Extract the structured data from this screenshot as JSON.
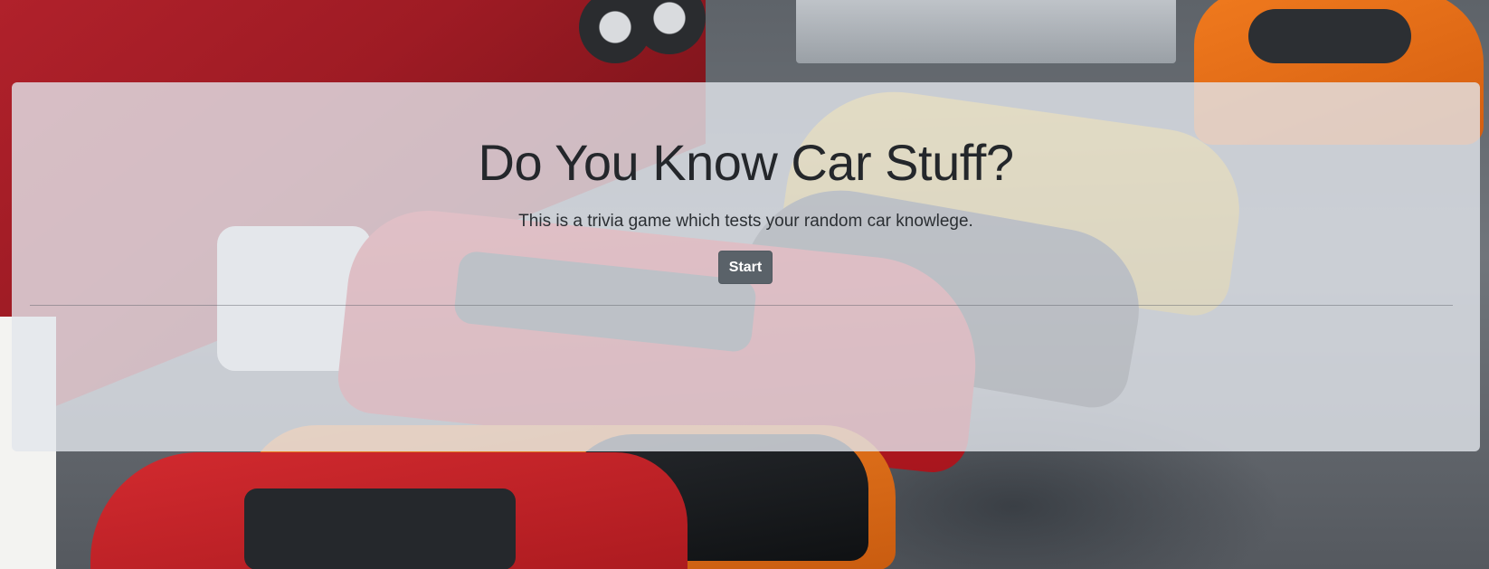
{
  "hero": {
    "title": "Do You Know Car Stuff?",
    "subtitle": "This is a trivia game which tests your random car knowlege.",
    "start_label": "Start"
  },
  "colors": {
    "panel_background": "#e2e6ec",
    "button_background": "#5a6269",
    "button_text": "#ffffff",
    "title_text": "#24272b"
  }
}
